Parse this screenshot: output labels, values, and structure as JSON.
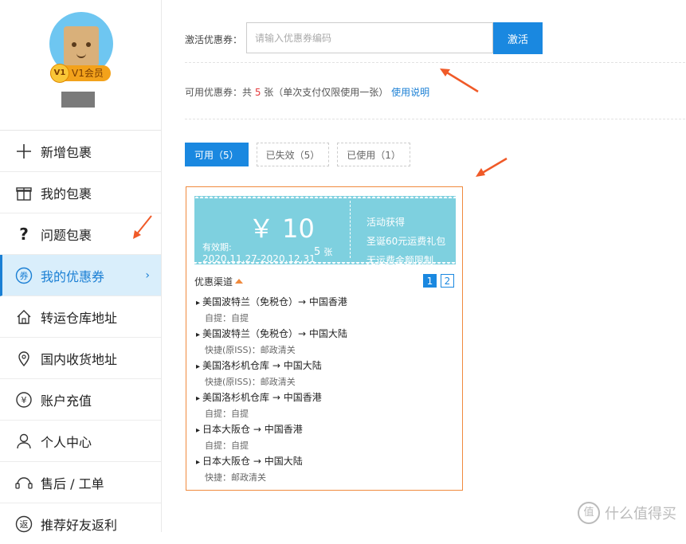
{
  "sidebar": {
    "vip_badge": "V1",
    "vip_label": "V1会员",
    "items": [
      {
        "label": "新增包裹",
        "icon": "plus-icon"
      },
      {
        "label": "我的包裹",
        "icon": "gift-icon"
      },
      {
        "label": "问题包裹",
        "icon": "question-icon"
      },
      {
        "label": "我的优惠券",
        "icon": "coupon-icon",
        "active": true
      },
      {
        "label": "转运仓库地址",
        "icon": "home-icon"
      },
      {
        "label": "国内收货地址",
        "icon": "location-icon"
      },
      {
        "label": "账户充值",
        "icon": "yen-icon"
      },
      {
        "label": "个人中心",
        "icon": "user-icon"
      },
      {
        "label": "售后 / 工单",
        "icon": "headset-icon"
      },
      {
        "label": "推荐好友返利",
        "icon": "return-icon"
      }
    ],
    "chevron": "›"
  },
  "activate": {
    "label": "激活优惠券：",
    "placeholder": "请输入优惠券编码",
    "button": "激活"
  },
  "available": {
    "prefix": "可用优惠券：共 ",
    "count": "5",
    "suffix": " 张（单次支付仅限使用一张）",
    "link": "使用说明"
  },
  "tabs": [
    "可用（5）",
    "已失效（5）",
    "已使用（1）"
  ],
  "coupon": {
    "amount": "￥ 10",
    "valid_label": "有效期:",
    "valid_dates": "2020.11.27-2020.12.31",
    "qty": "5",
    "qty_unit": "张",
    "info1": "活动获得",
    "info2": "圣诞60元运费礼包",
    "info3": "无运费金额限制",
    "channel_label": "优惠渠道",
    "pages": [
      "1",
      "2"
    ],
    "routes": [
      {
        "route": "美国波特兰（免税仓）→ 中国香港",
        "method": "自提：自提"
      },
      {
        "route": "美国波特兰（免税仓）→ 中国大陆",
        "method": "快捷(原ISS)：邮政清关"
      },
      {
        "route": "美国洛杉机仓库 → 中国大陆",
        "method": "快捷(原ISS)：邮政清关"
      },
      {
        "route": "美国洛杉机仓库 → 中国香港",
        "method": "自提：自提"
      },
      {
        "route": "日本大阪仓 → 中国香港",
        "method": "自提：自提"
      },
      {
        "route": "日本大阪仓 → 中国大陆",
        "method": "快捷：邮政清关"
      }
    ]
  },
  "watermark": {
    "icon": "值",
    "text": "什么值得买"
  },
  "colors": {
    "accent": "#1a88e0",
    "coupon_bg": "#7ed0df",
    "border_orange": "#f08a3e",
    "arrow": "#f05a28"
  }
}
